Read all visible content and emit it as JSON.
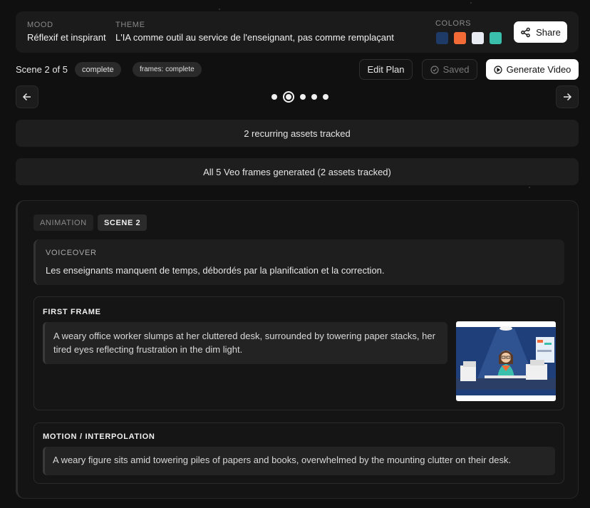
{
  "header": {
    "mood_label": "MOOD",
    "mood_value": "Réflexif et inspirant",
    "theme_label": "THEME",
    "theme_value": "L'IA comme outil au service de l'enseignant, pas comme remplaçant",
    "colors_label": "COLORS",
    "colors": [
      "#1e3a66",
      "#f26a35",
      "#e8ecf2",
      "#3bbfad"
    ],
    "share_label": "Share"
  },
  "scene_bar": {
    "scene_label": "Scene 2 of 5",
    "status_pill": "complete",
    "frames_pill": "frames: complete",
    "edit_label": "Edit Plan",
    "saved_label": "Saved",
    "generate_label": "Generate Video"
  },
  "nav": {
    "total": 5,
    "current": 2
  },
  "banners": {
    "assets": "2 recurring assets tracked",
    "frames": "All 5 Veo frames generated (2 assets tracked)"
  },
  "scene": {
    "tag_type": "ANIMATION",
    "tag_scene": "SCENE 2",
    "voiceover_label": "VOICEOVER",
    "voiceover_text": "Les enseignants manquent de temps, débordés par la planification et la correction.",
    "first_frame_label": "FIRST FRAME",
    "first_frame_text": "A weary office worker slumps at her cluttered desk, surrounded by towering paper stacks, her tired eyes reflecting frustration in the dim light.",
    "motion_label": "MOTION / INTERPOLATION",
    "motion_text": "A weary figure sits amid towering piles of papers and books, overwhelmed by the mounting clutter on their desk."
  }
}
